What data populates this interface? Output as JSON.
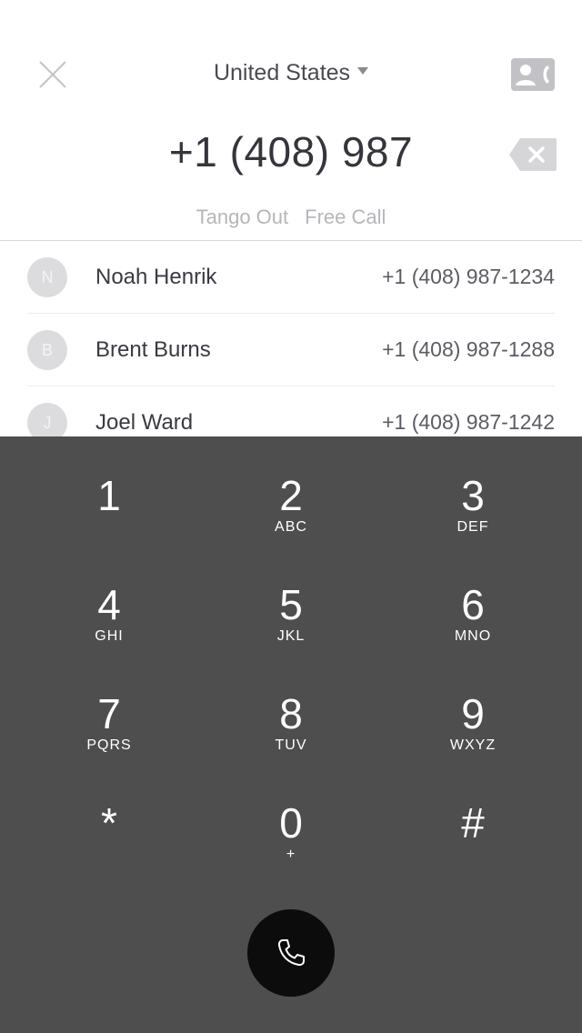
{
  "header": {
    "country": "United States",
    "number": "+1 (408) 987",
    "options": [
      "Tango Out",
      "Free Call"
    ]
  },
  "suggestions": [
    {
      "initial": "N",
      "name": "Noah Henrik",
      "phone": "+1 (408) 987-1234"
    },
    {
      "initial": "B",
      "name": "Brent Burns",
      "phone": "+1 (408) 987-1288"
    },
    {
      "initial": "J",
      "name": "Joel Ward",
      "phone": "+1 (408) 987-1242"
    }
  ],
  "keypad": {
    "keys": [
      {
        "digit": "1",
        "letters": ""
      },
      {
        "digit": "2",
        "letters": "ABC"
      },
      {
        "digit": "3",
        "letters": "DEF"
      },
      {
        "digit": "4",
        "letters": "GHI"
      },
      {
        "digit": "5",
        "letters": "JKL"
      },
      {
        "digit": "6",
        "letters": "MNO"
      },
      {
        "digit": "7",
        "letters": "PQRS"
      },
      {
        "digit": "8",
        "letters": "TUV"
      },
      {
        "digit": "9",
        "letters": "WXYZ"
      },
      {
        "digit": "*",
        "letters": ""
      },
      {
        "digit": "0",
        "letters": "+"
      },
      {
        "digit": "#",
        "letters": ""
      }
    ]
  },
  "icons": {
    "close": "close-icon",
    "contacts": "contact-call-icon",
    "backspace": "backspace-icon",
    "call": "phone-icon"
  },
  "colors": {
    "keypad_bg": "#4e4e4f",
    "call_button": "#0c0c0c",
    "muted_text": "#b6b6ba"
  }
}
